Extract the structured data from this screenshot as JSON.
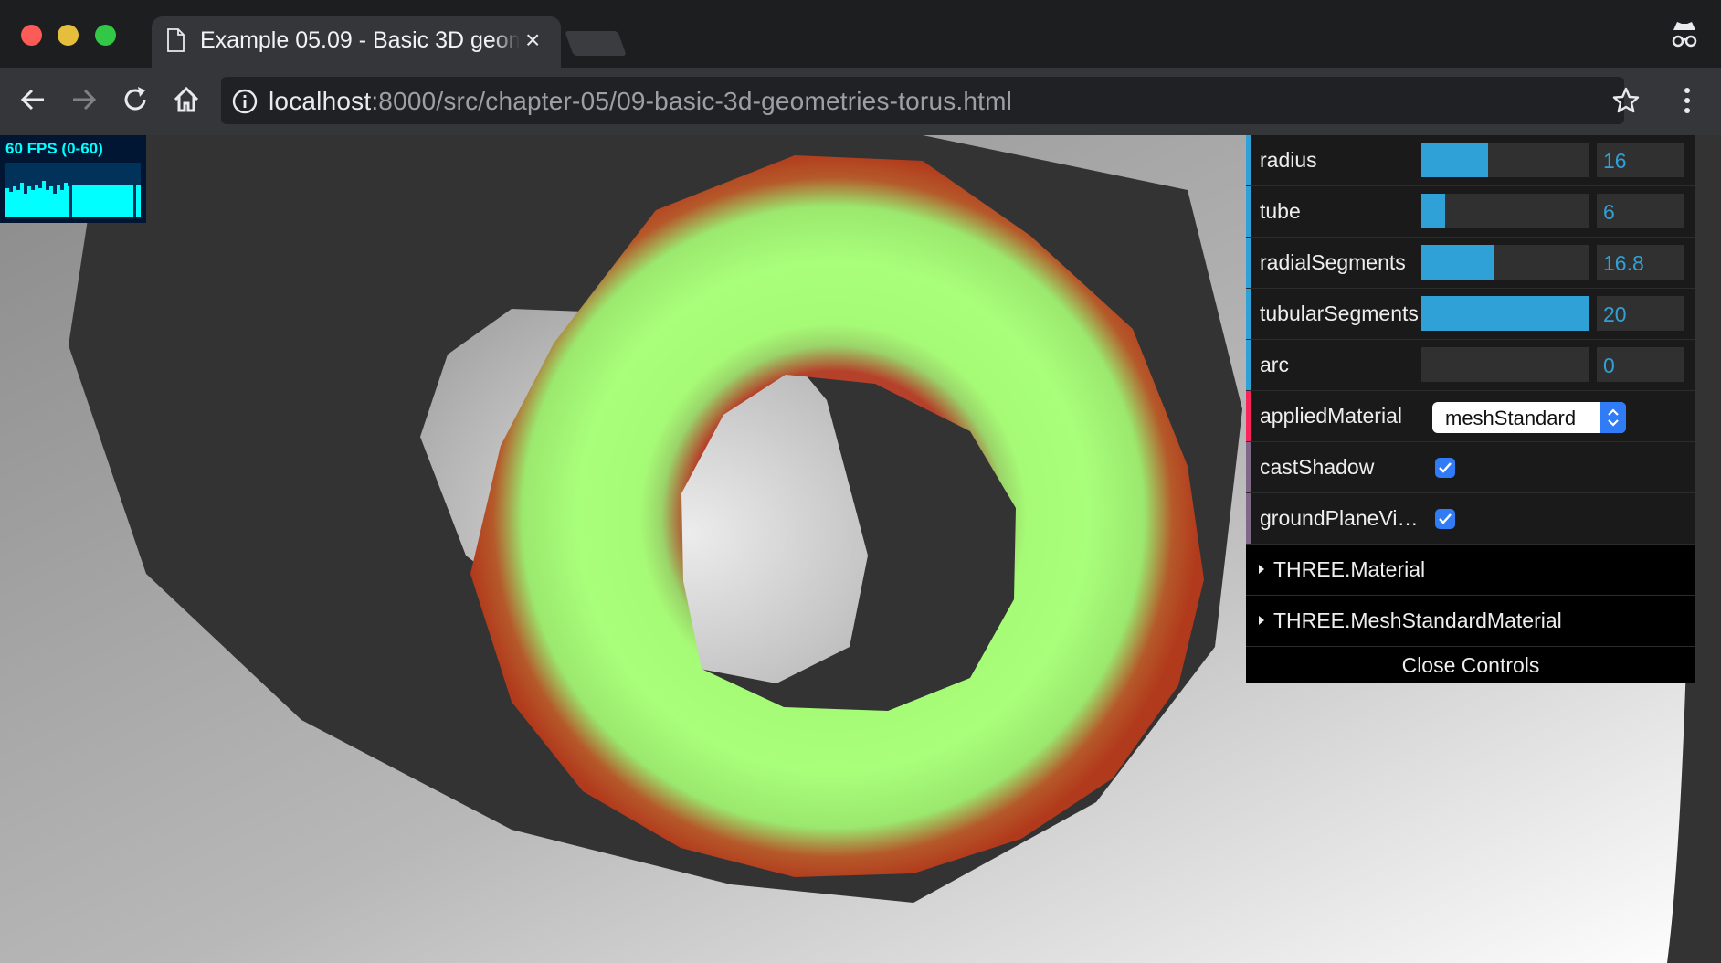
{
  "browser": {
    "tab_title": "Example 05.09 - Basic 3D geometries - Torus",
    "url_host": "localhost",
    "url_path": ":8000/src/chapter-05/09-basic-3d-geometries-torus.html"
  },
  "stats": {
    "fps_label": "60 FPS (0-60)"
  },
  "gui": {
    "controls": [
      {
        "label": "radius",
        "value": "16",
        "fill": 0.4
      },
      {
        "label": "tube",
        "value": "6",
        "fill": 0.14
      },
      {
        "label": "radialSegments",
        "value": "16.8",
        "fill": 0.43
      },
      {
        "label": "tubularSegments",
        "value": "20",
        "fill": 1.0
      },
      {
        "label": "arc",
        "value": "0",
        "fill": 0.0
      }
    ],
    "applied_material": {
      "label": "appliedMaterial",
      "value": "meshStandard"
    },
    "cast_shadow": {
      "label": "castShadow",
      "checked": true
    },
    "ground_plane": {
      "label": "groundPlaneVi…",
      "checked": true
    },
    "folders": [
      "THREE.Material",
      "THREE.MeshStandardMaterial"
    ],
    "close_label": "Close Controls"
  },
  "colors": {
    "accent_number": "#2fa1d6",
    "accent_option": "#f8265a",
    "accent_boolean": "#806787",
    "torus": "#a8ff78",
    "torus_edge": "#b83a1c"
  }
}
